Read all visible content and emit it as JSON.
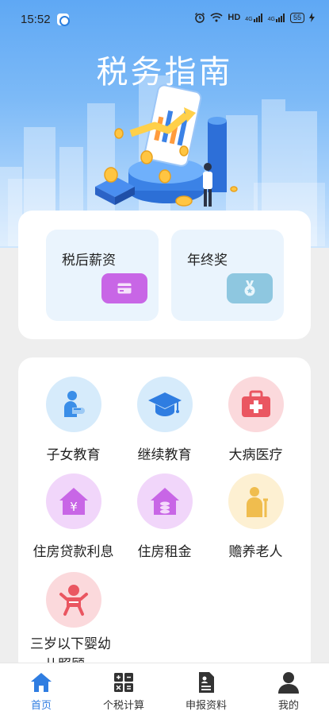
{
  "status": {
    "time": "15:52",
    "network": "HD",
    "signal1": "4G",
    "signal2": "4G",
    "battery": "55"
  },
  "hero": {
    "title": "税务指南"
  },
  "features": [
    {
      "label": "税后薪资",
      "icon": "card-icon",
      "color": "#c866e6"
    },
    {
      "label": "年终奖",
      "icon": "medal-icon",
      "color": "#8ec7e0"
    }
  ],
  "deductions": [
    {
      "label": "子女教育",
      "icon": "child-reading-icon",
      "bg": "#d6ebfb",
      "fg": "#3a8ee8"
    },
    {
      "label": "继续教育",
      "icon": "graduation-cap-icon",
      "bg": "#d6ebfb",
      "fg": "#2f7de1"
    },
    {
      "label": "大病医疗",
      "icon": "medical-kit-icon",
      "bg": "#fbd9dc",
      "fg": "#ea5661"
    },
    {
      "label": "住房贷款利息",
      "icon": "house-yuan-icon",
      "bg": "#f1d6fa",
      "fg": "#c866e6"
    },
    {
      "label": "住房租金",
      "icon": "house-coins-icon",
      "bg": "#f1d6fa",
      "fg": "#c866e6"
    },
    {
      "label": "赡养老人",
      "icon": "elderly-person-icon",
      "bg": "#fdf0d2",
      "fg": "#f0bd4e"
    },
    {
      "label": "三岁以下婴幼儿照顾",
      "label_line1": "三岁以下婴幼",
      "label_line2": "儿照顾",
      "icon": "baby-icon",
      "bg": "#fbd9dc",
      "fg": "#ea5661"
    }
  ],
  "tabs": [
    {
      "label": "首页",
      "icon": "home-icon",
      "active": true
    },
    {
      "label": "个税计算",
      "icon": "calculator-icon",
      "active": false
    },
    {
      "label": "申报资料",
      "icon": "document-icon",
      "active": false
    },
    {
      "label": "我的",
      "icon": "profile-icon",
      "active": false
    }
  ],
  "colors": {
    "accent": "#2f7de1",
    "hero_top": "#5fa8f4",
    "hero_bottom": "#cfe6fd",
    "background": "#eeeeee"
  }
}
